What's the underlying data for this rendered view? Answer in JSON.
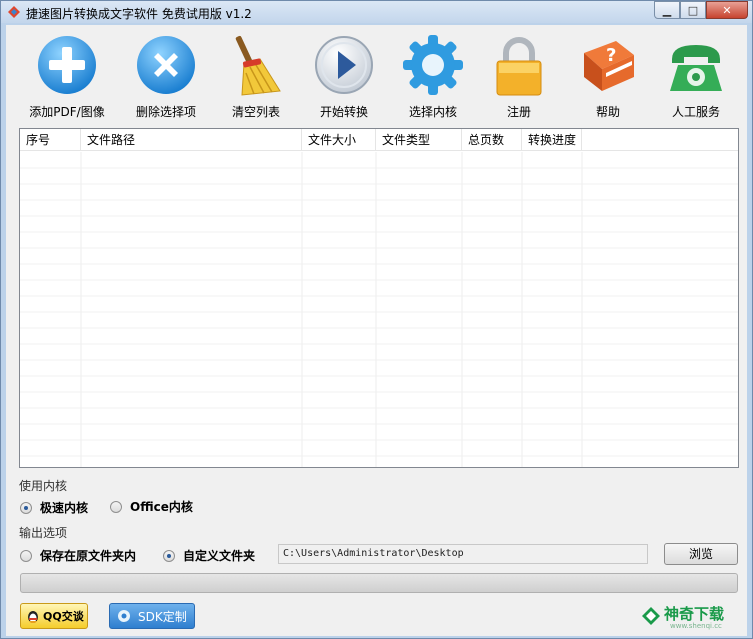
{
  "window": {
    "title": "捷速图片转换成文字软件 免费试用版 v1.2",
    "min_glyph": "▁",
    "max_glyph": "□",
    "close_glyph": "✕"
  },
  "toolbar": {
    "items": [
      {
        "label": "添加PDF/图像",
        "icon": "add-icon"
      },
      {
        "label": "删除选择项",
        "icon": "delete-icon"
      },
      {
        "label": "清空列表",
        "icon": "broom-icon"
      },
      {
        "label": "开始转换",
        "icon": "play-icon"
      },
      {
        "label": "选择内核",
        "icon": "gear-icon"
      },
      {
        "label": "注册",
        "icon": "lock-icon"
      },
      {
        "label": "帮助",
        "icon": "help-book-icon"
      },
      {
        "label": "人工服务",
        "icon": "phone-icon"
      }
    ]
  },
  "table": {
    "columns": [
      "序号",
      "文件路径",
      "文件大小",
      "文件类型",
      "总页数",
      "转换进度"
    ],
    "rows": []
  },
  "engine": {
    "label": "使用内核",
    "options": [
      {
        "label": "极速内核",
        "selected": true
      },
      {
        "label": "Office内核",
        "selected": false
      }
    ]
  },
  "output": {
    "label": "输出选项",
    "options": [
      {
        "label": "保存在原文件夹内",
        "selected": false
      },
      {
        "label": "自定义文件夹",
        "selected": true
      }
    ],
    "path": "C:\\Users\\Administrator\\Desktop",
    "browse_label": "浏览"
  },
  "progress": {
    "value": 0
  },
  "bottom": {
    "qq_label": "QQ交谈",
    "sdk_label": "SDK定制"
  },
  "watermark": {
    "text": "神奇下载",
    "sub": "www.shenqi.cc"
  },
  "colors": {
    "accent_blue": "#2f8fd8",
    "title_bar": "#c3d6ec",
    "watermark_green": "#1a9a4a"
  }
}
